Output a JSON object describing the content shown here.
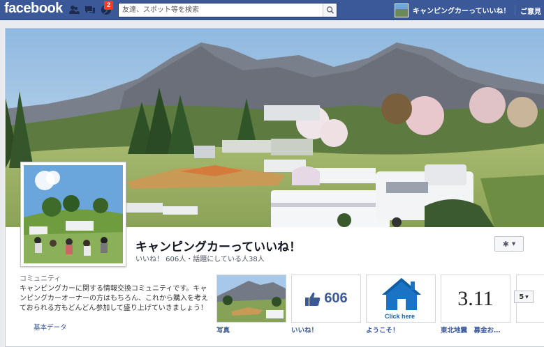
{
  "topbar": {
    "logo": "facebook",
    "notification_count": "2",
    "search_placeholder": "友達、スポット等を検索",
    "profile_name": "キャンピングカーっていいね！",
    "home_label": "ご意見"
  },
  "page": {
    "title": "キャンピングカーっていいね！",
    "stats": "いいね！ 606人・話題にしている人38人",
    "category": "コミュニティ",
    "about": "キャンピングカーに関する情報交換コミュニティです。キャンピングカーオーナーの方はもちろん、これから購入を考えておられる方もどんどん参加して盛り上げていきましょう！",
    "about_more": "基本データ"
  },
  "apps": [
    {
      "label": "写真"
    },
    {
      "label": "いいね！",
      "count": "606"
    },
    {
      "label": "ようこそ！",
      "button_text": "Click here"
    },
    {
      "label": "東北地震　募金お…",
      "tile_text": "3.11"
    }
  ],
  "more_apps_count": "5",
  "colors": {
    "fb_blue": "#3b5998",
    "link_blue": "#3b5998",
    "notification_red": "#f03d25"
  },
  "icons": {
    "friends": "friends-icon",
    "messages": "messages-icon",
    "notifications": "globe-icon",
    "search": "search-icon",
    "settings": "gear-icon",
    "thumbs_up": "thumbs-up-icon",
    "home": "house-icon"
  }
}
